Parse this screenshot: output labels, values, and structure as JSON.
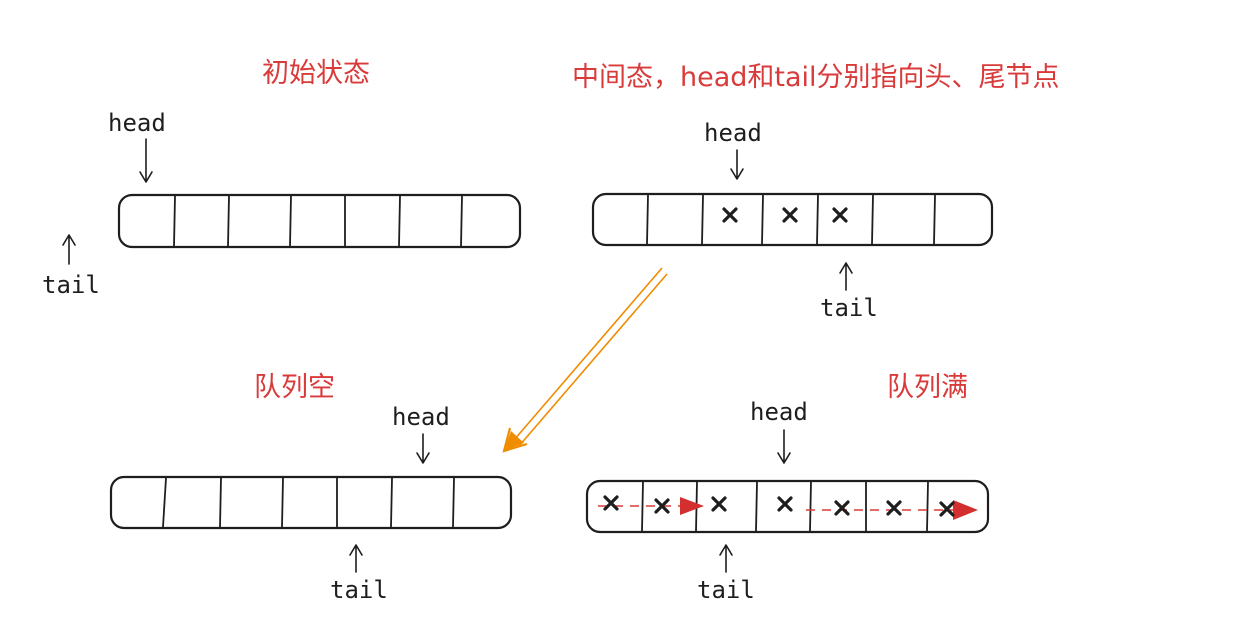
{
  "labels": {
    "initial": "初始状态",
    "middle": "中间态，head和tail分别指向头、尾节点",
    "empty": "队列空",
    "full": "队列满",
    "head": "head",
    "tail": "tail"
  },
  "mark": "x",
  "colors": {
    "title": "#d93a3a",
    "ink": "#1e1e1e",
    "transition_arrow": "#f08c00",
    "full_arrow": "#d32f2f"
  },
  "queues": [
    {
      "id": "initial",
      "slots": 7,
      "filled": []
    },
    {
      "id": "middle",
      "slots": 7,
      "filled": [
        2,
        3,
        4
      ]
    },
    {
      "id": "empty",
      "slots": 7,
      "filled": []
    },
    {
      "id": "full",
      "slots": 7,
      "filled": [
        0,
        1,
        2,
        3,
        4,
        5,
        6
      ]
    }
  ]
}
